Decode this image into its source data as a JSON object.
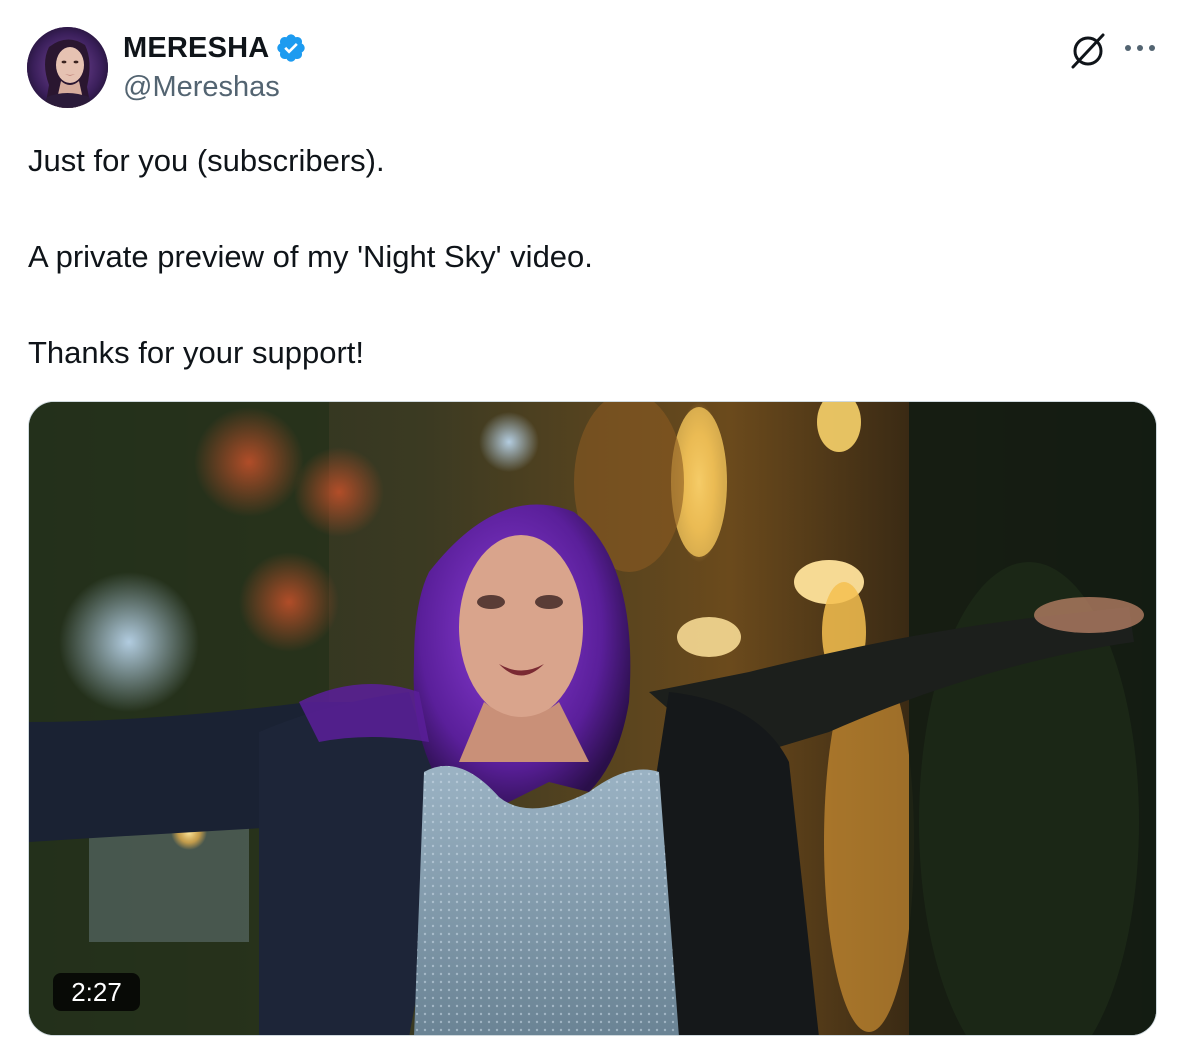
{
  "author": {
    "display_name": "MERESHA",
    "handle": "@Mereshas",
    "verified": true,
    "verified_color": "#1d9bf0"
  },
  "icons": {
    "grok": "grok-icon",
    "more": "more-icon",
    "verified": "verified-badge-icon"
  },
  "tweet": {
    "lines": [
      "Just for you (subscribers).",
      "A private preview of my 'Night Sky' video.",
      "Thanks for your support!"
    ]
  },
  "media": {
    "type": "video",
    "duration": "2:27"
  },
  "colors": {
    "text": "#0f1419",
    "secondary_text": "#536471",
    "border": "#cfd9de"
  }
}
